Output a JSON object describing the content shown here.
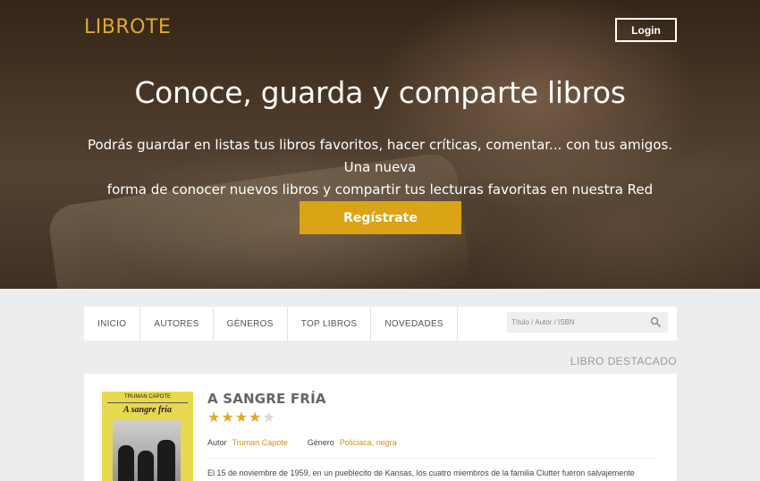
{
  "brand": {
    "logo": "LIBROTE",
    "accent_color": "#dba316"
  },
  "header": {
    "login_label": "Login"
  },
  "hero": {
    "title": "Conoce, guarda y comparte libros",
    "subtitle_line1": "Podrás guardar en listas tus libros favoritos, hacer críticas, comentar... con tus amigos. Una nueva",
    "subtitle_line2": "forma de conocer nuevos libros y compartir tus lecturas favoritas en nuestra Red Social.",
    "cta_label": "Regístrate"
  },
  "nav": {
    "items": [
      {
        "label": "INICIO"
      },
      {
        "label": "AUTORES"
      },
      {
        "label": "GÉNEROS"
      },
      {
        "label": "TOP LIBROS"
      },
      {
        "label": "NOVEDADES"
      }
    ],
    "search_placeholder": "Título / Autor / ISBN",
    "search_icon": "search-icon"
  },
  "featured": {
    "section_label": "LIBRO DESTACADO",
    "cover_author": "TRUMAN CAPOTE",
    "cover_title": "A sangre fría",
    "title": "A SANGRE FRÍA",
    "rating": 4,
    "rating_max": 5,
    "author_label": "Autor",
    "author": "Truman Capote",
    "genre_label": "Género",
    "genre": "Policiaca, negra",
    "synopsis": "El 15 de noviembre de 1959, en un pueblecito de Kansas, los cuatro miembros de la familia Clutter fueron salvajemente"
  }
}
